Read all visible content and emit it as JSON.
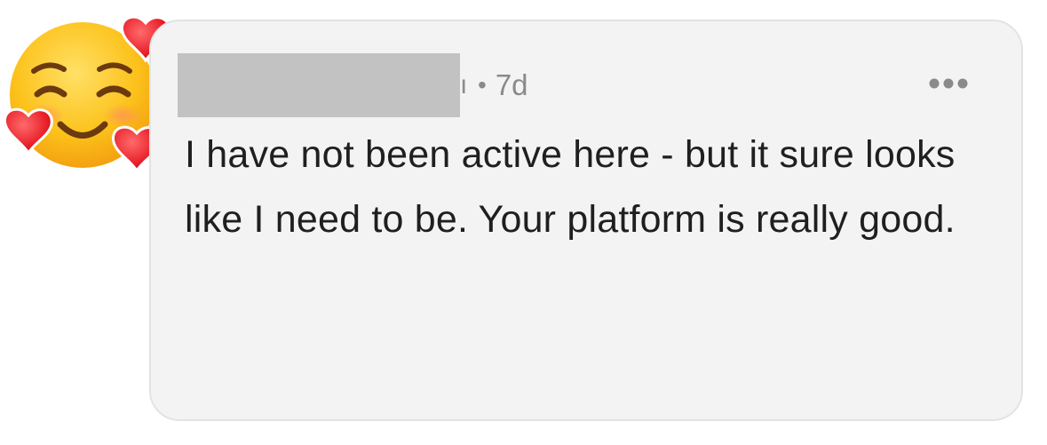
{
  "comment": {
    "author_tail": "ı",
    "separator": "•",
    "timestamp": "7d",
    "body": "I have not been active here - but it sure looks like I need to be. Your platform is really good."
  },
  "icons": {
    "avatar": "smiling-face-with-hearts-emoji",
    "more": "more-options-ellipsis-icon"
  },
  "colors": {
    "card_background": "#f3f3f3",
    "card_border": "#e3e3e3",
    "redaction": "#c2c2c2",
    "meta_text": "#8a8a8a",
    "body_text": "#1f1f1f",
    "heart": "#e8202a",
    "face": "#fbbf2e"
  }
}
